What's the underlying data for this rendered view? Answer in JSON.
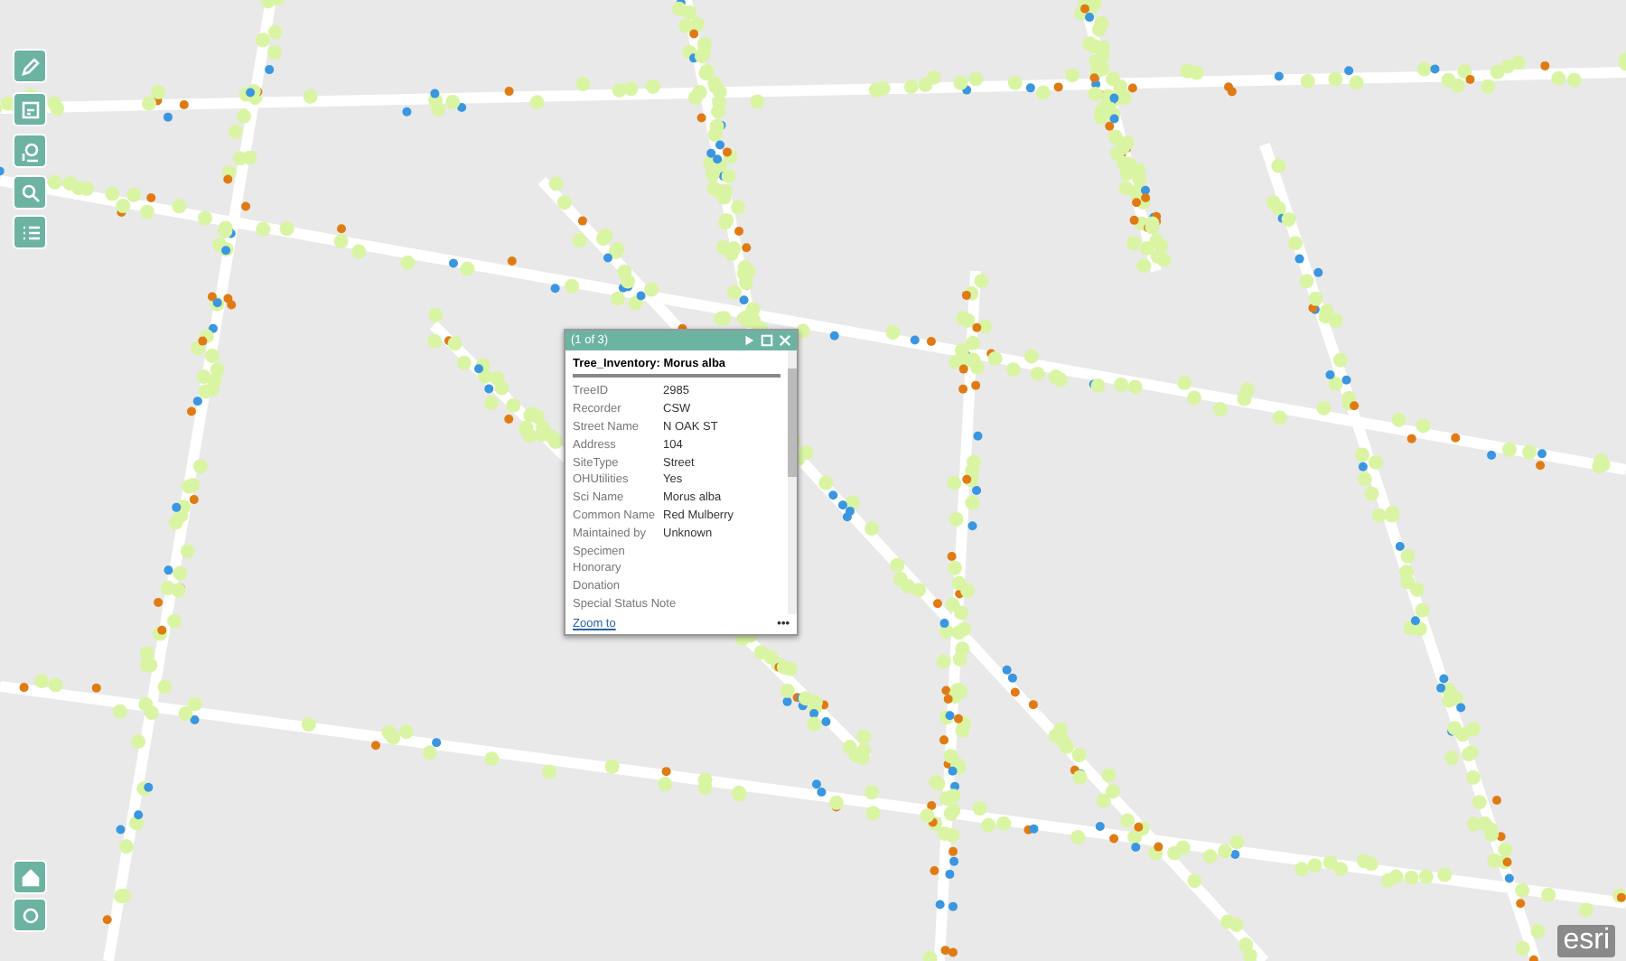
{
  "popup": {
    "counter": "(1 of 3)",
    "title": "Tree_Inventory: Morus alba",
    "fields": [
      {
        "label": "TreeID",
        "value": "2985"
      },
      {
        "label": "Recorder",
        "value": "CSW"
      },
      {
        "label": "Street Name",
        "value": "N OAK ST"
      },
      {
        "label": "Address",
        "value": "104"
      },
      {
        "label": "SiteType",
        "value": "Street"
      },
      {
        "label": "OHUtilities",
        "value": "Yes"
      },
      {
        "label": "Sci Name",
        "value": "Morus alba"
      },
      {
        "label": "Common Name",
        "value": "Red Mulberry"
      },
      {
        "label": "Maintained by",
        "value": "Unknown"
      },
      {
        "label": "Specimen"
      },
      {
        "label": "Honorary"
      },
      {
        "label": "Donation"
      },
      {
        "label": "Special Status Note"
      }
    ],
    "zoom_link": "Zoom to",
    "more": "•••"
  },
  "logo": "esri"
}
